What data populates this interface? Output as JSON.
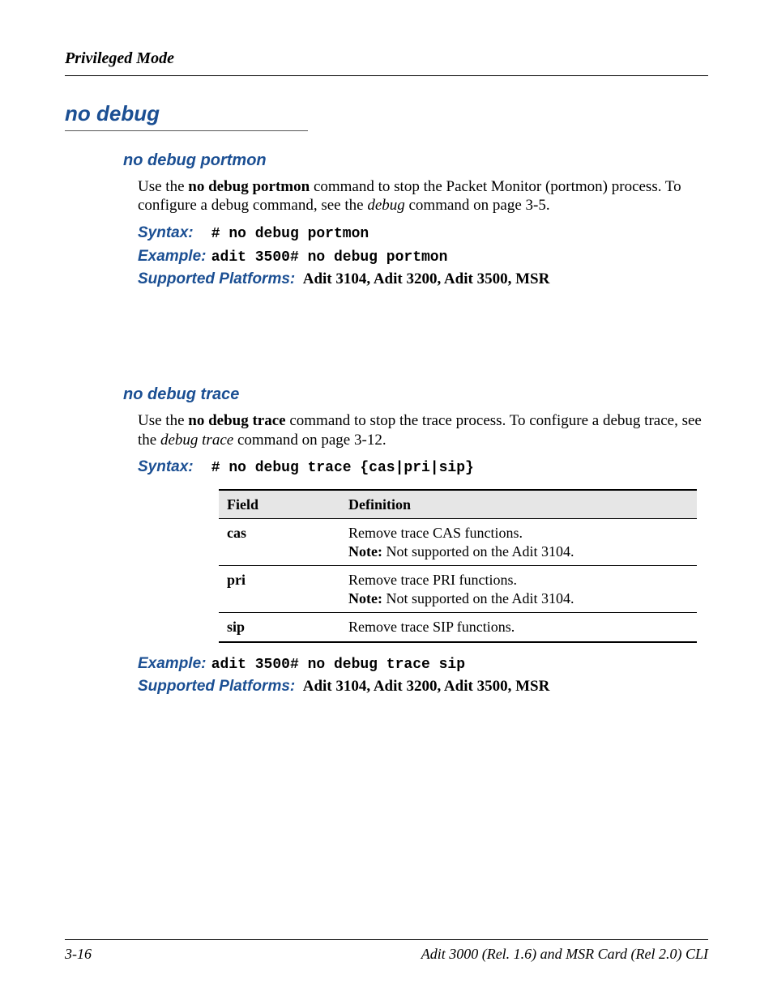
{
  "running_head": "Privileged Mode",
  "h1": "no debug",
  "sections": {
    "portmon": {
      "title": "no debug portmon",
      "para_parts": {
        "p1a": "Use the ",
        "p1b_bold": "no debug portmon",
        "p1c": " command to stop the Packet Monitor (portmon) process. To configure a debug command, see the ",
        "p1d_italic": "debug",
        "p1e": " command on page 3-5."
      },
      "syntax_label": "Syntax:",
      "syntax_value": "# no debug portmon",
      "example_label": "Example:",
      "example_value": "adit 3500# no debug portmon",
      "platforms_label": "Supported Platforms:",
      "platforms_value": "Adit 3104, Adit 3200, Adit 3500, MSR"
    },
    "trace": {
      "title": "no debug trace",
      "para_parts": {
        "p1a": "Use the ",
        "p1b_bold": "no debug trace",
        "p1c": " command to stop the trace process. To configure a debug trace, see the ",
        "p1d_italic": "debug trace",
        "p1e": " command on page 3-12."
      },
      "syntax_label": "Syntax:",
      "syntax_value": "# no debug trace {cas|pri|sip}",
      "table": {
        "headers": {
          "field": "Field",
          "definition": "Definition"
        },
        "rows": [
          {
            "field": "cas",
            "def_line1": "Remove trace CAS functions.",
            "note_label": "Note:",
            "note_text": " Not supported on the Adit 3104."
          },
          {
            "field": "pri",
            "def_line1": "Remove trace PRI functions.",
            "note_label": "Note:",
            "note_text": " Not supported on the Adit 3104."
          },
          {
            "field": "sip",
            "def_line1": "Remove trace SIP functions.",
            "note_label": "",
            "note_text": ""
          }
        ]
      },
      "example_label": "Example:",
      "example_value": "adit 3500# no debug trace sip",
      "platforms_label": "Supported Platforms:",
      "platforms_value": "Adit 3104, Adit 3200, Adit 3500, MSR"
    }
  },
  "footer": {
    "left": "3-16",
    "right": "Adit 3000 (Rel. 1.6) and MSR Card (Rel 2.0) CLI"
  }
}
